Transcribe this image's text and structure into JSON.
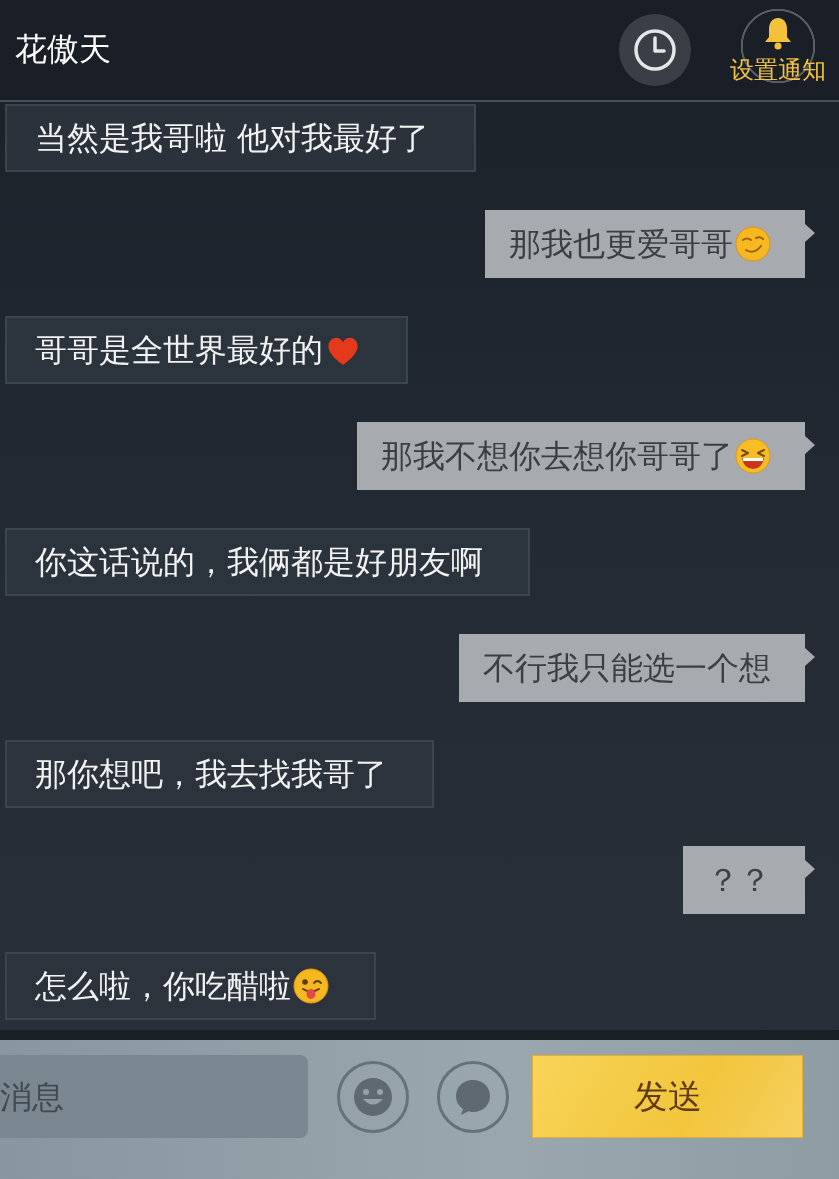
{
  "header": {
    "title": "花傲天",
    "notify_label": "设置通知"
  },
  "messages": [
    {
      "kind": "received",
      "text": "当然是我哥啦 他对我最好了"
    },
    {
      "kind": "sent",
      "text": "那我也更爱哥哥",
      "emoji": {
        "kind": "smirk"
      }
    },
    {
      "kind": "received",
      "text": "哥哥是全世界最好的",
      "emoji": {
        "kind": "heart"
      }
    },
    {
      "kind": "sent",
      "text": "那我不想你去想你哥哥了",
      "emoji": {
        "kind": "laugh"
      }
    },
    {
      "kind": "received",
      "text": "你这话说的，我俩都是好朋友啊"
    },
    {
      "kind": "sent",
      "text": "不行我只能选一个想"
    },
    {
      "kind": "received",
      "text": "那你想吧，我去找我哥了"
    },
    {
      "kind": "sent",
      "text": "？？"
    },
    {
      "kind": "received",
      "text": "怎么啦，你吃醋啦",
      "emoji": {
        "kind": "tongue_wink"
      }
    }
  ],
  "composer": {
    "placeholder": "消息",
    "send_label": "发送"
  }
}
